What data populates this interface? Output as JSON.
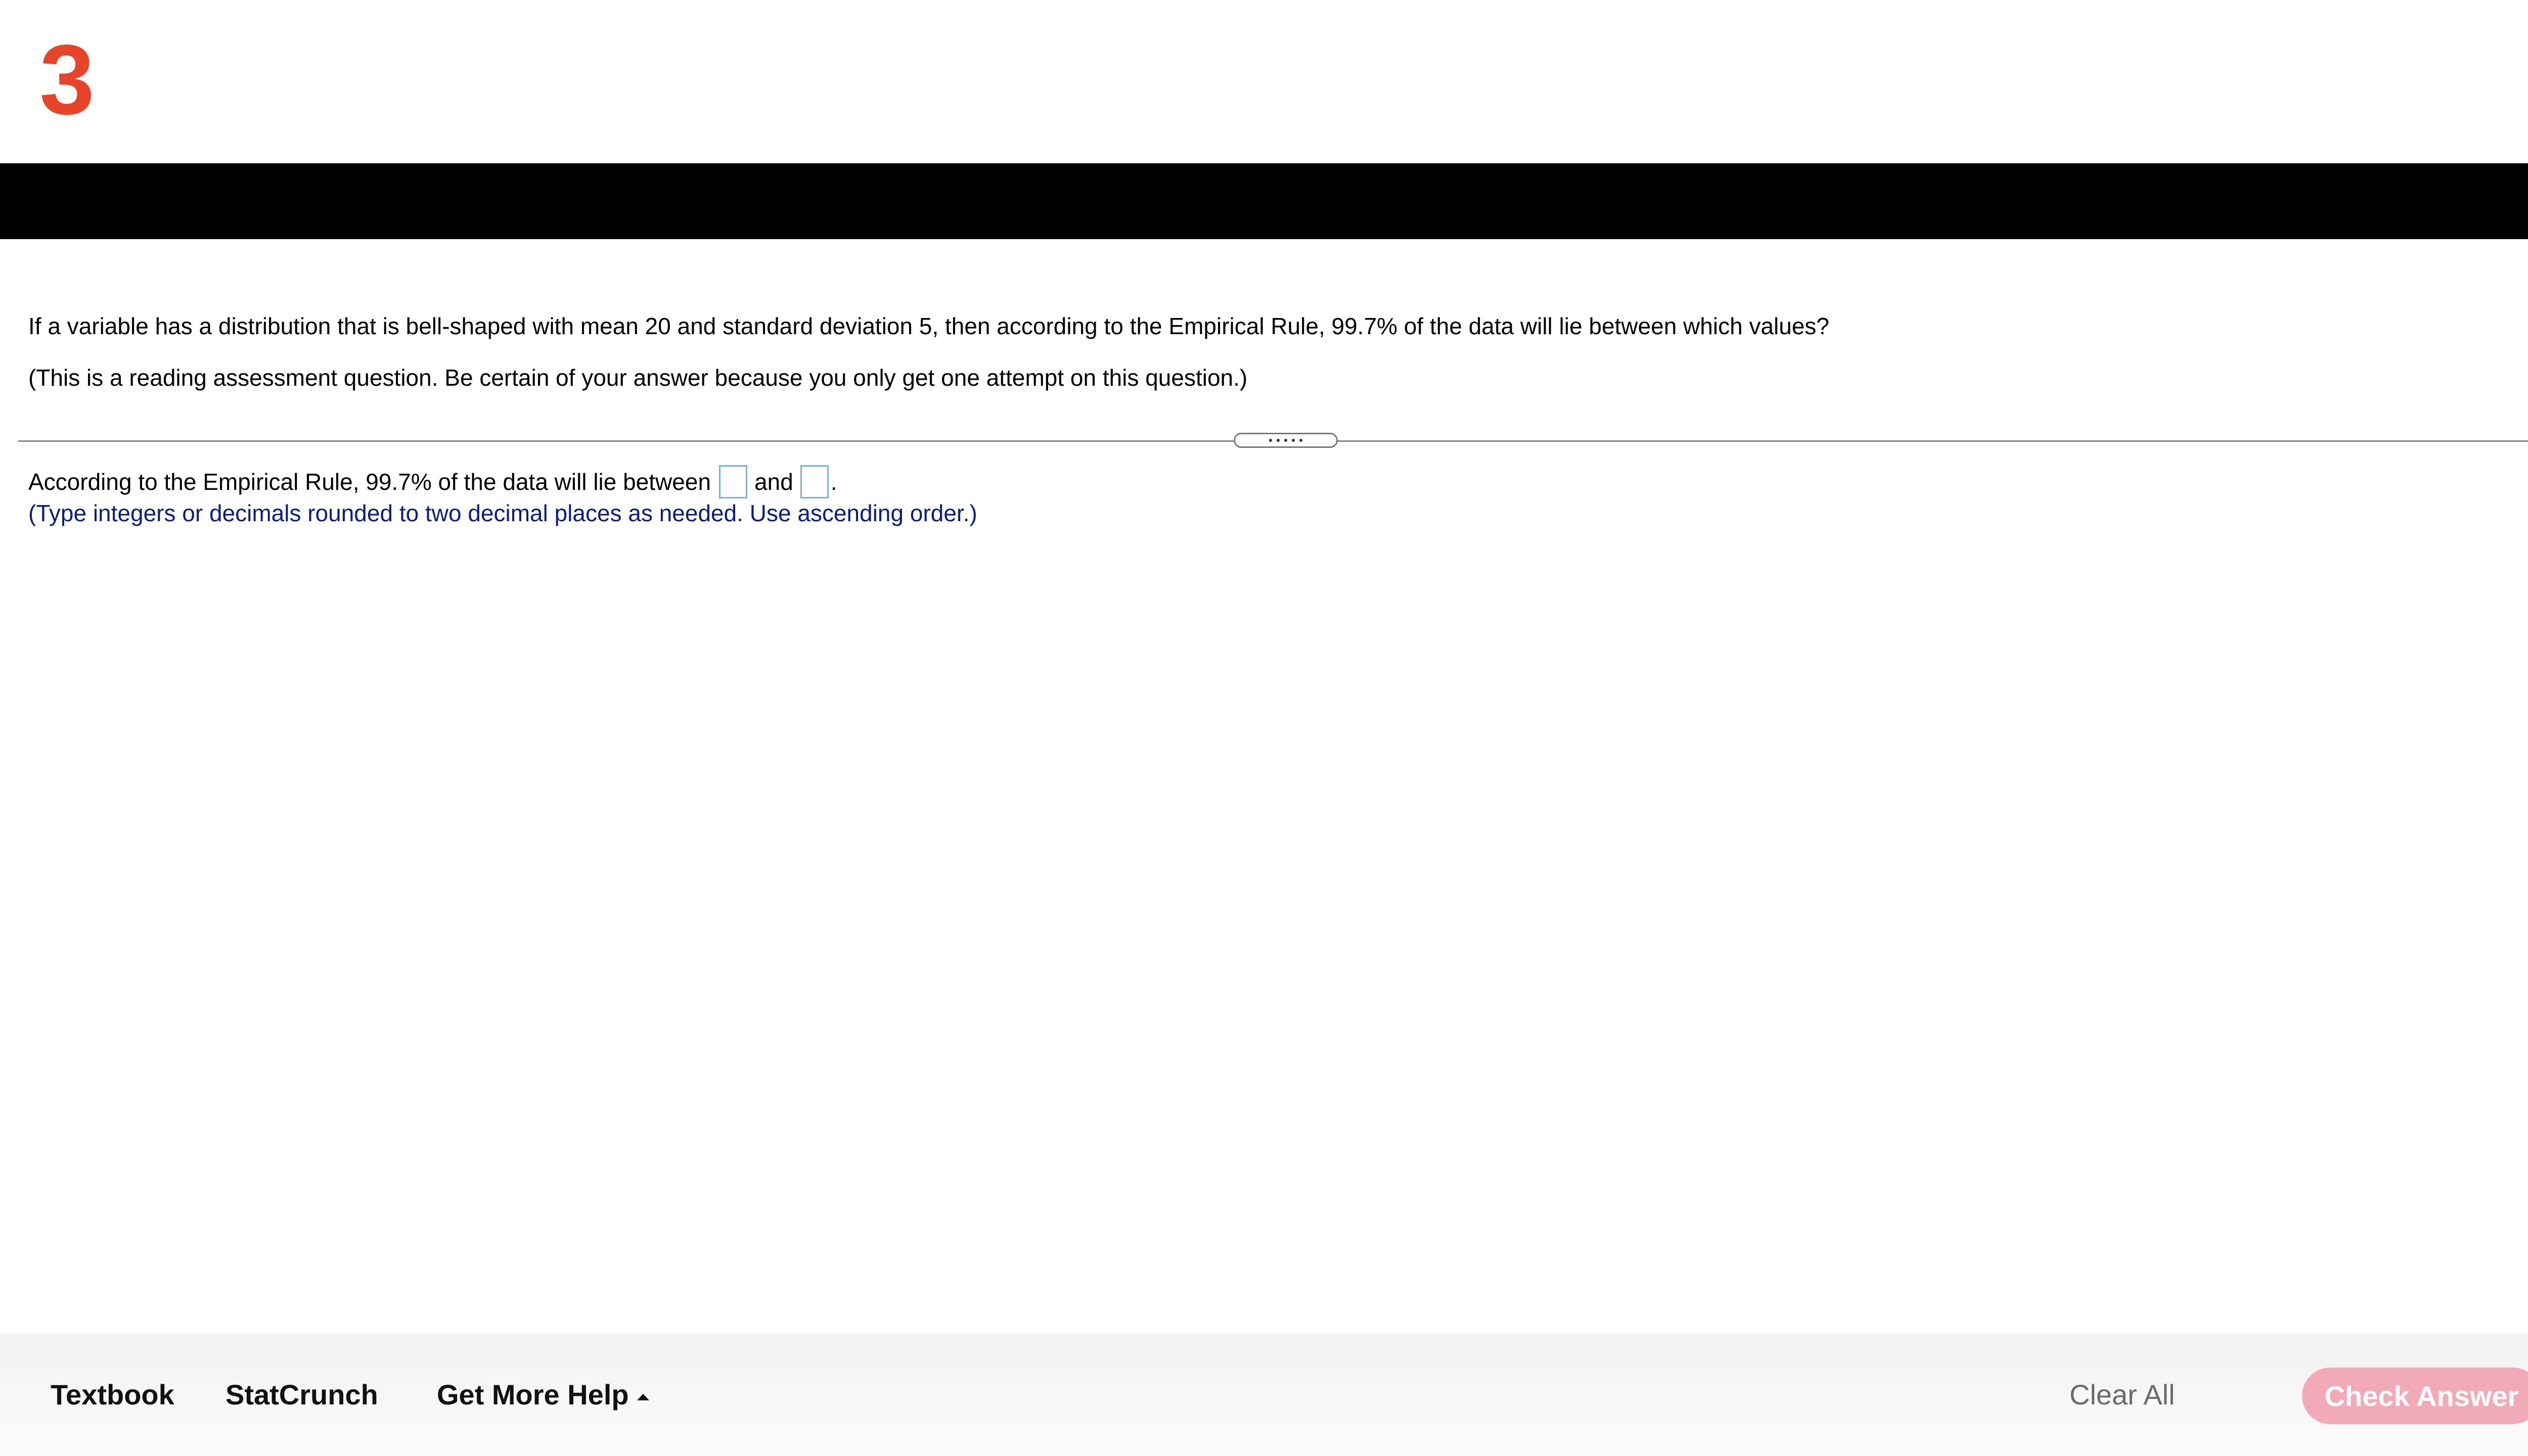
{
  "question": {
    "number": "3",
    "prompt": "If a variable has a distribution that is bell-shaped with mean 20 and standard deviation 5, then according to the Empirical Rule, 99.7% of the data will lie between which values?",
    "note": "(This is a reading assessment question. Be certain of your answer because you only get one attempt on this question.)"
  },
  "answer": {
    "lead_text": "According to the Empirical Rule, 99.7% of the data will lie between",
    "between_text": "and",
    "end_text": ".",
    "input1_value": "",
    "input2_value": "",
    "hint": "(Type integers or decimals rounded to two decimal places as needed. Use ascending order.)"
  },
  "footer": {
    "textbook_label": "Textbook",
    "statcrunch_label": "StatCrunch",
    "more_help_label": "Get More Help",
    "clear_all_label": "Clear All",
    "check_answer_label": "Check Answer"
  },
  "colors": {
    "question_number": "#e8432b",
    "header_bar": "#000000",
    "hint_text": "#0b1f7a",
    "check_answer_bg": "#f3aab8",
    "answer_box_border": "#7fb0d8"
  },
  "icons": {
    "more_help_caret": "caret-up-icon",
    "divider_handle": "drag-handle-icon"
  }
}
